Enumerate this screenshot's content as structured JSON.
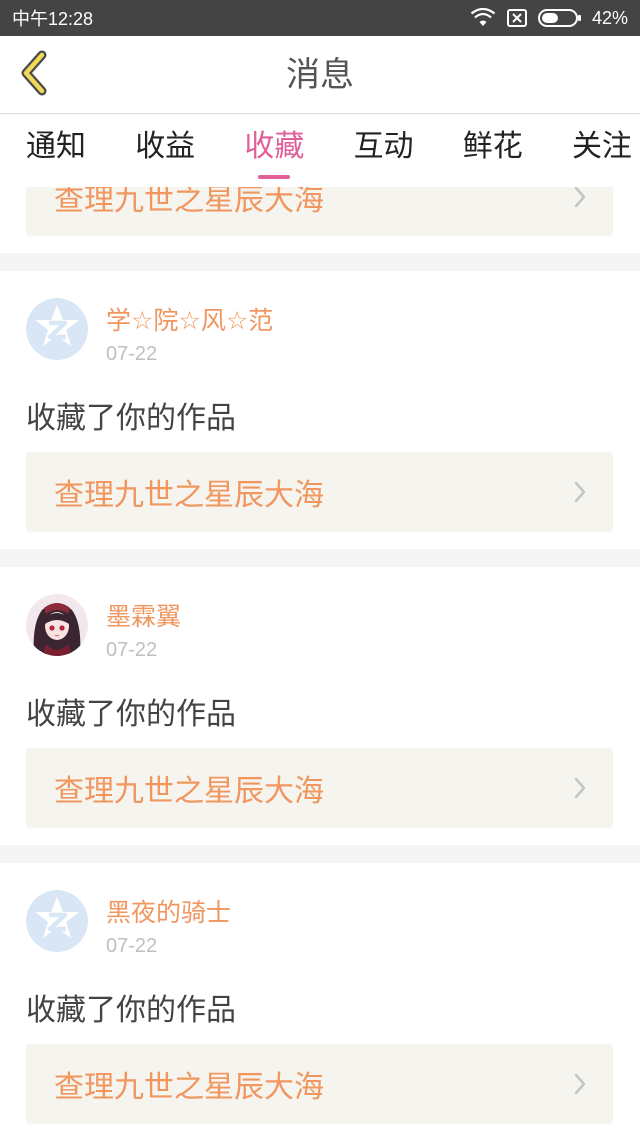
{
  "status_bar": {
    "time": "中午12:28",
    "battery": "42%"
  },
  "header": {
    "title": "消息",
    "back_icon": "chevron-left-icon"
  },
  "tabs": [
    {
      "label": "通知",
      "active": false
    },
    {
      "label": "收益",
      "active": false
    },
    {
      "label": "收藏",
      "active": true
    },
    {
      "label": "互动",
      "active": false
    },
    {
      "label": "鲜花",
      "active": false
    },
    {
      "label": "关注",
      "active": false
    }
  ],
  "colors": {
    "accent": "#e0609a",
    "username": "#f0965e",
    "status_bar": "#444444",
    "link_bg": "#f5f4ef"
  },
  "partial_card": {
    "work_title": "查理九世之星辰大海"
  },
  "messages": [
    {
      "username": "学☆院☆风☆范",
      "date": "07-22",
      "avatar": "default-avatar-icon",
      "action": "收藏了你的作品",
      "work_title": "查理九世之星辰大海"
    },
    {
      "username": "墨霖翼",
      "date": "07-22",
      "avatar": "anime-girl-avatar",
      "action": "收藏了你的作品",
      "work_title": "查理九世之星辰大海"
    },
    {
      "username": "黑夜的骑士",
      "date": "07-22",
      "avatar": "default-avatar-icon",
      "action": "收藏了你的作品",
      "work_title": "查理九世之星辰大海"
    }
  ]
}
